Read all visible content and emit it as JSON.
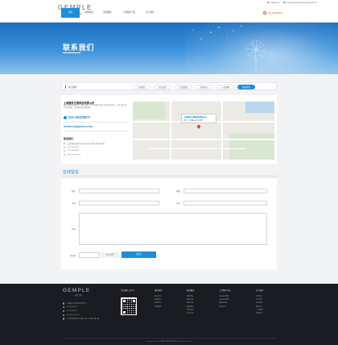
{
  "topbar": {
    "email": "Jx@s.com",
    "site": "www.gemple-biotechnology.com.cn"
  },
  "header": {
    "logo_text": "GEMPLE",
    "logo_sub": "捷步生物",
    "phone": "021-60400870",
    "nav": [
      {
        "label": "首页",
        "active": true
      },
      {
        "label": "捷步肽剂",
        "active": false
      },
      {
        "label": "肽剂服务",
        "active": false
      },
      {
        "label": "二代测序产品",
        "active": false
      },
      {
        "label": "关于捷步",
        "active": false
      }
    ]
  },
  "banner": {
    "title": "联系我们"
  },
  "subnav": {
    "crumb": "关于捷步",
    "tabs": [
      {
        "label": "公司简介",
        "active": false
      },
      {
        "label": "企业文化",
        "active": false
      },
      {
        "label": "企业荣誉",
        "active": false
      },
      {
        "label": "新闻中心",
        "active": false
      },
      {
        "label": "人才招聘",
        "active": false
      },
      {
        "label": "联系我们",
        "active": true
      }
    ]
  },
  "contact": {
    "company": "上海捷步生物科技有限公司",
    "intro": "捷步生物下属公司是一家以研发、生产和销售为核心的高科技企业，公司主营业务为生物试剂、实验耗材及仪器设备。",
    "phone": "021-60400870",
    "email": "sxdor@jayaxx.com",
    "heading": "联系我们",
    "rows": [
      "上海市浦东新区华江路166弄10号楼 I 幢 F座 F室",
      "+021 60400870",
      "+021 60400870",
      "www.gemple.com"
    ],
    "map_popup_title": "上海捷步生物科技有限公司",
    "map_popup_addr": "地址：华江路166弄10号楼"
  },
  "form": {
    "title": "在线留言",
    "name_label": "姓名",
    "email_label": "邮箱",
    "phone_label": "手机",
    "company_label": "公司",
    "content_label": "内容",
    "captcha_label": "验证码",
    "captcha_text": "4u9E",
    "submit_label": "提 交"
  },
  "footer": {
    "logo_text": "GEMPLE",
    "logo_sub": "捷步生物",
    "info": [
      "上海捷步生物科技有限公司",
      "021-60400870",
      "021-60400870",
      "info@gemple.com",
      "上海市浦东新区华江路166弄10号楼 I 幢 F座"
    ],
    "qr_title": "关注捷步公众号",
    "columns": [
      {
        "title": "捷步肽剂",
        "items": [
          "核心肽剂",
          "多肽肽剂",
          "肽剂定制",
          "肽剂服务"
        ]
      },
      {
        "title": "肽剂服务",
        "items": [
          "服务项目",
          "服务流程",
          "服务方案",
          "质量控制",
          "常见问题",
          "核心技术"
        ]
      },
      {
        "title": "二代测序产品",
        "items": [
          "RNA文库建库",
          "DNA文库建库",
          "捕获试剂盒",
          "测序试剂"
        ]
      },
      {
        "title": "关于捷步",
        "items": [
          "公司简介",
          "企业文化",
          "企业荣誉",
          "新闻中心",
          "人才招聘",
          "联系我们"
        ]
      }
    ],
    "copyright": "Copyright © 2019 上海捷步生物科技有限公司. All rights reserved."
  },
  "colors": {
    "accent": "#1f8ddb",
    "footer_bg": "#1a1c21",
    "phone": "#e2552f"
  }
}
